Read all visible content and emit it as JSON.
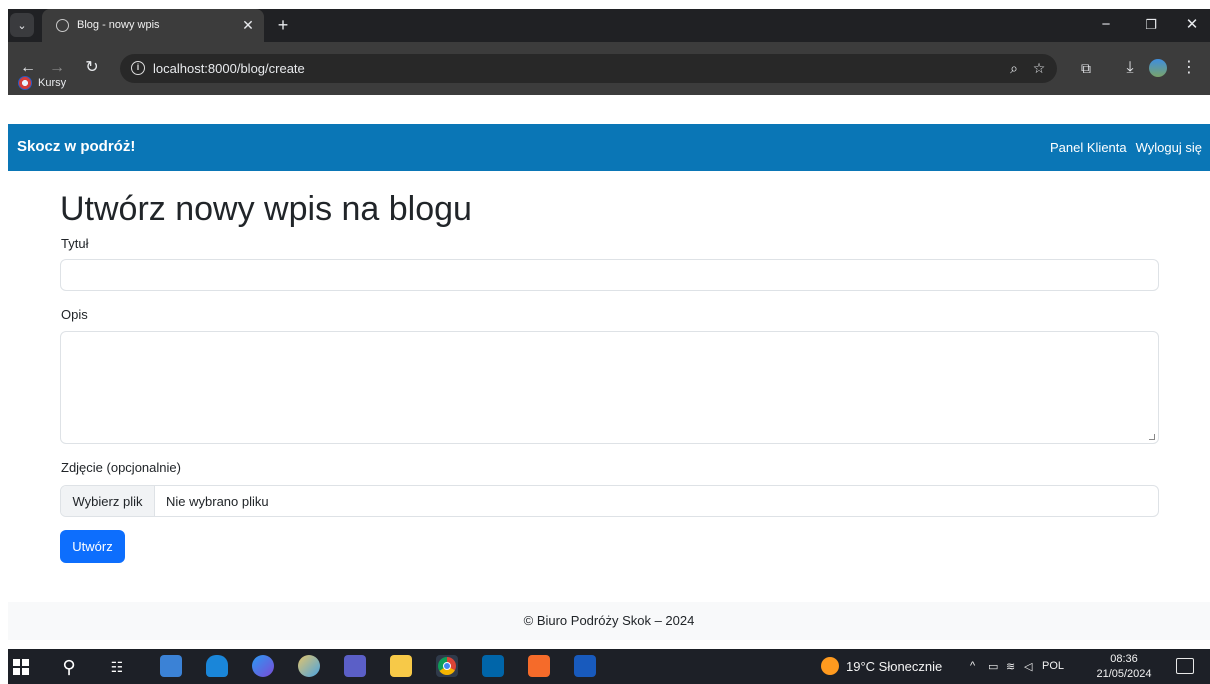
{
  "browser": {
    "tab_title": "Blog - nowy wpis",
    "url": "localhost:8000/blog/create",
    "bookmark_label": "Kursy",
    "icons": [
      "tab-search-icon",
      "globe-icon",
      "close-icon",
      "plus-icon",
      "minimize-icon",
      "restore-icon",
      "close-window-icon",
      "back-icon",
      "forward-icon",
      "reload-icon",
      "info-icon",
      "zoom-icon",
      "star-icon",
      "extensions-icon",
      "download-icon",
      "profile-icon",
      "menu-icon"
    ]
  },
  "nav": {
    "brand": "Skocz w podróż!",
    "links": [
      "Panel Klienta",
      "Wyloguj się"
    ],
    "bg_color": "#0a76b6"
  },
  "form": {
    "heading": "Utwórz nowy wpis na blogu",
    "title_label": "Tytuł",
    "title_value": "",
    "description_label": "Opis",
    "description_value": "",
    "photo_label": "Zdjęcie (opcjonalnie)",
    "file_button": "Wybierz plik",
    "file_status": "Nie wybrano pliku",
    "submit_label": "Utwórz",
    "submit_color": "#0d6efd"
  },
  "footer": {
    "text": "© Biuro Podróży Skok – 2024"
  },
  "taskbar": {
    "weather": "19°C Słonecznie",
    "language": "POL",
    "time": "08:36",
    "date": "21/05/2024",
    "icons": [
      "windows-icon",
      "search-icon",
      "task-view-icon",
      "store-icon",
      "mail-icon",
      "copilot-icon",
      "paint-icon",
      "teams-icon",
      "file-explorer-icon",
      "chrome-icon",
      "vscode-icon",
      "xampp-icon",
      "word-icon"
    ]
  }
}
